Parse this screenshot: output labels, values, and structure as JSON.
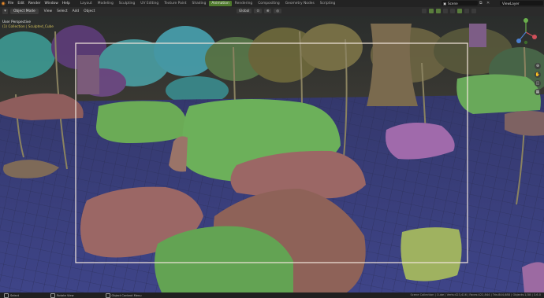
{
  "menu": [
    "File",
    "Edit",
    "Render",
    "Window",
    "Help"
  ],
  "workspaces": [
    {
      "label": "Layout",
      "active": false
    },
    {
      "label": "Modeling",
      "active": false
    },
    {
      "label": "Sculpting",
      "active": false
    },
    {
      "label": "UV Editing",
      "active": false
    },
    {
      "label": "Texture Paint",
      "active": false
    },
    {
      "label": "Shading",
      "active": false
    },
    {
      "label": "Animation",
      "active": true
    },
    {
      "label": "Rendering",
      "active": false
    },
    {
      "label": "Compositing",
      "active": false
    },
    {
      "label": "Geometry Nodes",
      "active": false
    },
    {
      "label": "Scripting",
      "active": false
    }
  ],
  "scene": {
    "name": "Scene"
  },
  "view_layer": {
    "name": "ViewLayer"
  },
  "viewport_header": {
    "mode": "Object Mode",
    "menus": [
      "View",
      "Select",
      "Add",
      "Object"
    ],
    "transform_orientation": "Global"
  },
  "overlay": {
    "view_name": "User Perspective",
    "collection": "(1) Collection | Sculpted_Cube"
  },
  "statusbar": {
    "select": "Select",
    "rotate": "Rotate View",
    "context": "Object Context Menu",
    "stats": "Scene Collection | Cube | Verts:423,416 | Faces:422,844 | Tris:844,688 | Objects:1/38 | 3.6.0"
  },
  "colors": {
    "accent_active_tab": "#4f7a2c",
    "camera_frame": "#f2e6dc",
    "ground": "#3a3f78",
    "green_rock": "#6bab56",
    "brown_rock": "#9b6765",
    "purple_rock": "#a06aab"
  },
  "icons": [
    "blender-logo-icon",
    "scene-icon",
    "view-layer-icon",
    "gizmo-axis-icon",
    "zoom-icon",
    "pan-hand-icon",
    "camera-view-icon",
    "grid-icon"
  ]
}
